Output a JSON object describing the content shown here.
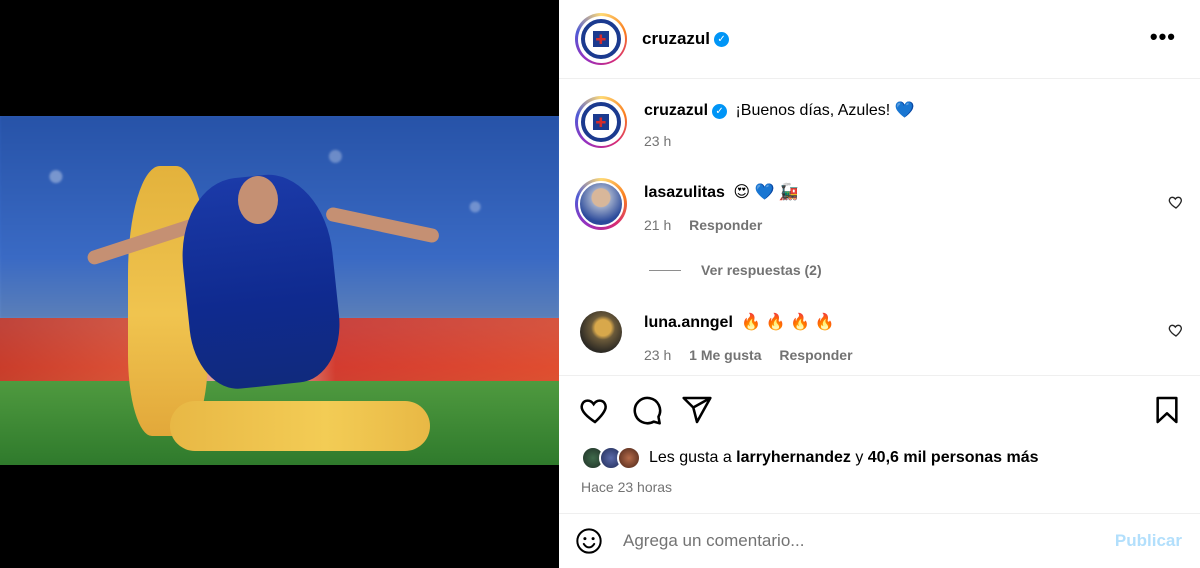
{
  "post": {
    "username": "cruzazul",
    "verified": true,
    "more_icon": "more-horizontal-icon",
    "caption": "¡Buenos días, Azules! 💙",
    "caption_time": "23 h"
  },
  "comments": [
    {
      "username": "lasazulitas",
      "text": "😍 💙 🚂",
      "time": "21 h",
      "likes": "",
      "reply_label": "Responder",
      "view_replies": "Ver respuestas (2)"
    },
    {
      "username": "luna.anngel",
      "text": "🔥 🔥 🔥 🔥",
      "time": "23 h",
      "likes": "1 Me gusta",
      "reply_label": "Responder"
    }
  ],
  "actions": {
    "like_icon": "heart-icon",
    "comment_icon": "comment-icon",
    "share_icon": "share-icon",
    "save_icon": "bookmark-icon"
  },
  "likes": {
    "prefix": "Les gusta a ",
    "user": "larryhernandez",
    "suffix": " y ",
    "count": "40,6 mil personas más"
  },
  "post_time": "Hace 23 horas",
  "composer": {
    "placeholder": "Agrega un comentario...",
    "publish_label": "Publicar",
    "emoji_icon": "emoji-icon"
  },
  "colors": {
    "accent": "#0095f6",
    "publish_disabled": "#b2dffc",
    "secondary_text": "#737373"
  }
}
